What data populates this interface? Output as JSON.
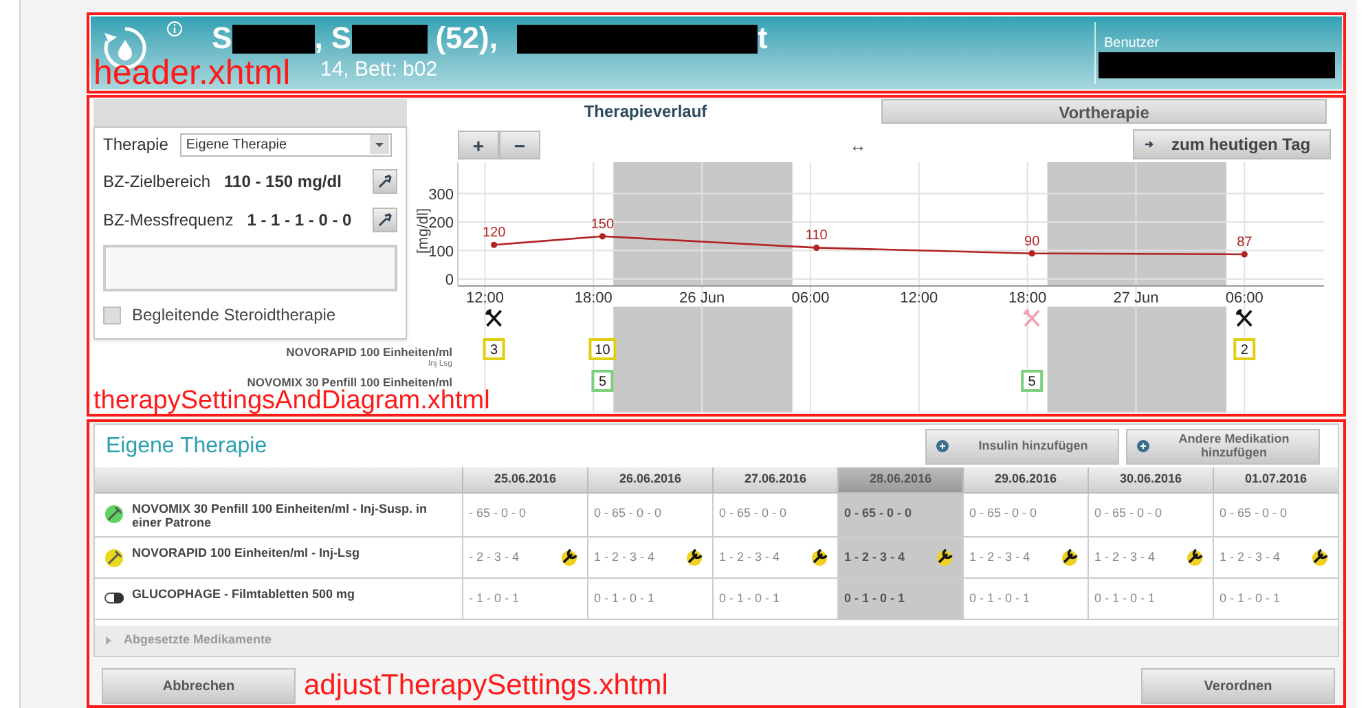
{
  "header": {
    "name_parts": [
      "S",
      ", S",
      " (52),",
      "t"
    ],
    "location": "14, Bett: b02",
    "user_label": "Benutzer"
  },
  "therapy_panel": {
    "therapy_label": "Therapie",
    "therapy_value": "Eigene Therapie",
    "target_label": "BZ-Zielbereich",
    "target_value": "110 - 150 mg/dl",
    "frequency_label": "BZ-Messfrequenz",
    "frequency_value": "1 - 1 - 1 - 0 - 0",
    "steroid": {
      "label": "Begleitende Steroidtherapie",
      "checked": false
    }
  },
  "tabs": [
    {
      "label": "Therapieverlauf",
      "selected": true
    },
    {
      "label": "Vortherapie",
      "selected": false
    }
  ],
  "chart_controls": {
    "zoom_in": "+",
    "zoom_out": "−",
    "pan": "↔",
    "today": "zum heutigen Tag"
  },
  "chart_data": {
    "type": "line",
    "ylabel": "[mg/dl]",
    "x": [
      "2016-06-25T12:30",
      "2016-06-25T18:30",
      "2016-06-26T06:20",
      "2016-06-26T18:15",
      "2016-06-27T06:00"
    ],
    "series": [
      {
        "color": "#b22222",
        "marker": "circle",
        "values": [
          120,
          150,
          110,
          90,
          87
        ]
      }
    ],
    "xlim": [
      "2016-06-25T10:30",
      "2016-06-27T10:24"
    ],
    "ylim": [
      0,
      410
    ],
    "yticks": [
      0,
      100,
      200,
      300
    ],
    "xticks": [
      {
        "value": "2016-06-25T12:00",
        "label": "12:00"
      },
      {
        "value": "2016-06-25T18:00",
        "label": "18:00"
      },
      {
        "value": "2016-06-26T00:00",
        "label": "26 Jun"
      },
      {
        "value": "2016-06-26T06:00",
        "label": "06:00"
      },
      {
        "value": "2016-06-26T12:00",
        "label": "12:00"
      },
      {
        "value": "2016-06-26T18:00",
        "label": "18:00"
      },
      {
        "value": "2016-06-27T00:00",
        "label": "27 Jun"
      },
      {
        "value": "2016-06-27T06:00",
        "label": "06:00"
      }
    ],
    "grid": true,
    "data_labels": true,
    "bands": [
      {
        "axis": "x",
        "from": "2016-06-25T19:06",
        "to": "2016-06-26T05:00",
        "color": "#c8c8c8"
      },
      {
        "axis": "x",
        "from": "2016-06-26T19:06",
        "to": "2016-06-27T05:00",
        "color": "#c8c8c8"
      }
    ]
  },
  "meal_markers": [
    {
      "kind": "meal"
    },
    {
      "kind": "empty"
    },
    {
      "kind": "empty"
    },
    {
      "kind": "skipped"
    },
    {
      "kind": "meal"
    }
  ],
  "dose_rows": [
    {
      "name": "NOVORAPID 100 Einheiten/ml",
      "form": "Inj Lsg",
      "color": "#e0cf10",
      "doses": [
        {
          "kind": "dose",
          "value": "3"
        },
        {
          "kind": "dose",
          "value": "10"
        },
        {
          "kind": "empty"
        },
        {
          "kind": "empty"
        },
        {
          "kind": "dose",
          "value": "2"
        }
      ]
    },
    {
      "name": "NOVOMIX 30 Penfill 100 Einheiten/ml",
      "color": "#7ccf7c",
      "doses": [
        {
          "kind": "empty"
        },
        {
          "kind": "dose",
          "value": "5"
        },
        {
          "kind": "empty"
        },
        {
          "kind": "dose",
          "value": "5"
        },
        {
          "kind": "empty"
        }
      ]
    }
  ],
  "own_therapy": {
    "title": "Eigene Therapie",
    "buttons": [
      "Insulin hinzufügen",
      "Andere Medikation hinzufügen"
    ],
    "dates": [
      {
        "label": "25.06.2016",
        "selected": false
      },
      {
        "label": "26.06.2016",
        "selected": false
      },
      {
        "label": "27.06.2016",
        "selected": false
      },
      {
        "label": "28.06.2016",
        "selected": true
      },
      {
        "label": "29.06.2016",
        "selected": false
      },
      {
        "label": "30.06.2016",
        "selected": false
      },
      {
        "label": "01.07.2016",
        "selected": false
      }
    ],
    "rows": [
      {
        "kind": "insulin",
        "color": "#5fd35f",
        "name": "NOVOMIX 30 Penfill 100 Einheiten/ml - Inj-Susp. in einer Patrone",
        "adjustable": false,
        "cells": [
          "- 65 - 0 - 0",
          "0 - 65 - 0 - 0",
          "0 - 65 - 0 - 0",
          "0 - 65 - 0 - 0",
          "0 - 65 - 0 - 0",
          "0 - 65 - 0 - 0",
          "0 - 65 - 0 - 0"
        ]
      },
      {
        "kind": "insulin",
        "color": "#e8d820",
        "name": "NOVORAPID 100 Einheiten/ml - Inj-Lsg",
        "adjustable": true,
        "cells": [
          "- 2 - 3 - 4",
          "1 - 2 - 3 - 4",
          "1 - 2 - 3 - 4",
          "1 - 2 - 3 - 4",
          "1 - 2 - 3 - 4",
          "1 - 2 - 3 - 4",
          "1 - 2 - 3 - 4"
        ]
      },
      {
        "kind": "pill",
        "name": "GLUCOPHAGE - Filmtabletten 500 mg",
        "adjustable": false,
        "cells": [
          "- 1 - 0 - 1",
          "0 - 1 - 0 - 1",
          "0 - 1 - 0 - 1",
          "0 - 1 - 0 - 1",
          "0 - 1 - 0 - 1",
          "0 - 1 - 0 - 1",
          "0 - 1 - 0 - 1"
        ]
      }
    ],
    "discontinued": {
      "label": "Abgesetzte Medikamente",
      "expanded": false
    },
    "cancel": "Abbrechen",
    "order": "Verordnen"
  },
  "annotations": [
    {
      "label": "header.xhtml"
    },
    {
      "label": "therapySettingsAndDiagram.xhtml"
    },
    {
      "label": "adjustTherapySettings.xhtml"
    }
  ]
}
